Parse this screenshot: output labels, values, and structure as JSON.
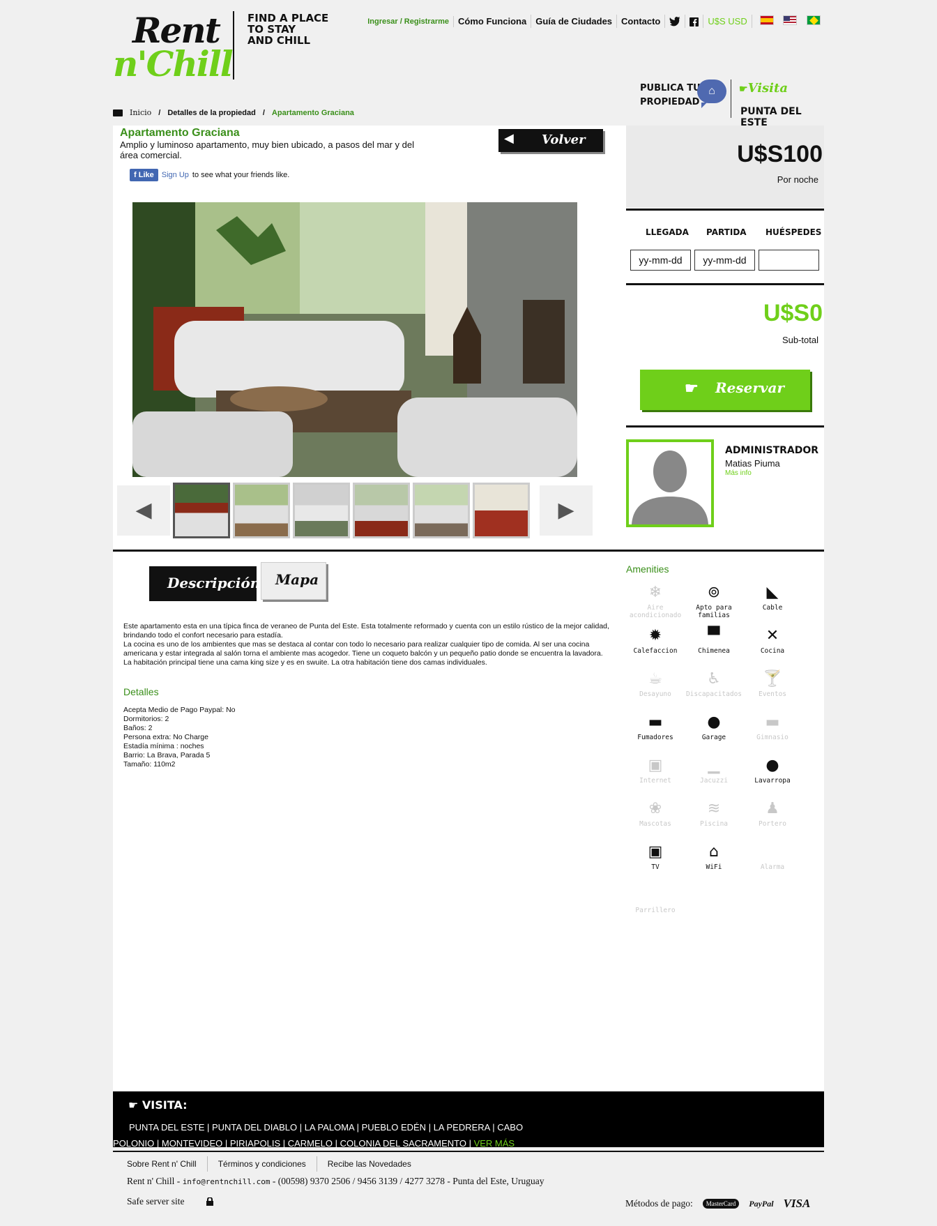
{
  "header": {
    "logo_line1": "Rent",
    "logo_line2": "n'Chill",
    "tagline_l1": "FIND A PLACE",
    "tagline_l2": "TO STAY",
    "tagline_l3": "AND CHILL",
    "nav": {
      "login": "Ingresar / Registrarme",
      "como": "Cómo Funciona",
      "guia": "Guía de Ciudades",
      "contacto": "Contacto",
      "currency": "U$S USD"
    },
    "publica_l1": "PUBLICA TU",
    "publica_l2": "PROPIEDAD",
    "visita": "Visita",
    "visita_city": "PUNTA DEL ESTE",
    "accent": "#6fcf1a"
  },
  "breadcrumb": {
    "home": "Inicio",
    "details": "Detalles de la propiedad",
    "current": "Apartamento Graciana"
  },
  "property": {
    "title": "Apartamento Graciana",
    "subtitle": "Amplio y luminoso apartamento, muy bien ubicado, a pasos del mar y del área comercial.",
    "volver": "Volver",
    "fb_like": "Like",
    "fb_signup": "Sign Up",
    "fb_text": "to see what your friends like."
  },
  "booking": {
    "price": "U$S100",
    "per_night": "Por noche",
    "llegada": "LLEGADA",
    "partida": "PARTIDA",
    "huespedes": "HUÉSPEDES",
    "llegada_placeholder": "yy-mm-dd",
    "partida_placeholder": "yy-mm-dd",
    "subtotal": "U$S0",
    "subtotal_label": "Sub-total",
    "reservar": "Reservar"
  },
  "admin": {
    "heading": "ADMINISTRADOR",
    "name": "Matias Piuma",
    "more": "Más info"
  },
  "tabs": {
    "descripcion": "Descripción",
    "mapa": "Mapa"
  },
  "description": {
    "p1": "Este apartamento esta en una típica finca de veraneo de Punta del Este. Esta totalmente reformado y cuenta con un estilo rústico de la mejor calidad, brindando todo el confort necesario para estadía.",
    "p2": "La cocina es uno de los ambientes que mas se destaca al contar con todo lo necesario para realizar cualquier tipo de comida. Al ser una cocina americana y estar integrada al salón torna el ambiente mas acogedor. Tiene un coqueto balcón y un pequeño patio donde se encuentra la lavadora.",
    "p3": "La habitación principal tiene una cama king size y es en swuite. La otra habitación tiene dos camas individuales."
  },
  "details": {
    "heading": "Detalles",
    "lines": [
      "Acepta Medio de Pago Paypal: No",
      "Dormitorios: 2",
      "Baños: 2",
      "Persona extra: No Charge",
      "Estadía mínima : noches",
      "Barrio: La Brava, Parada 5",
      "Tamaño: 110m2"
    ]
  },
  "amenities": {
    "heading": "Amenities",
    "items": [
      {
        "label": "Aire acondicionado",
        "on": false,
        "icon": "snowflake-icon",
        "glyph": "❄"
      },
      {
        "label": "Apto para familias",
        "on": true,
        "icon": "lollipop-icon",
        "glyph": "⊚"
      },
      {
        "label": "Cable",
        "on": true,
        "icon": "satellite-icon",
        "glyph": "◣"
      },
      {
        "label": "Calefaccion",
        "on": true,
        "icon": "heater-icon",
        "glyph": "✹"
      },
      {
        "label": "Chimenea",
        "on": true,
        "icon": "chimney-icon",
        "glyph": "▀"
      },
      {
        "label": "Cocina",
        "on": true,
        "icon": "utensils-icon",
        "glyph": "✕"
      },
      {
        "label": "Desayuno",
        "on": false,
        "icon": "cup-icon",
        "glyph": "☕"
      },
      {
        "label": "Discapacitados",
        "on": false,
        "icon": "wheelchair-icon",
        "glyph": "♿"
      },
      {
        "label": "Eventos",
        "on": false,
        "icon": "cocktail-icon",
        "glyph": "🍸"
      },
      {
        "label": "Fumadores",
        "on": true,
        "icon": "cigarette-icon",
        "glyph": "▬"
      },
      {
        "label": "Garage",
        "on": true,
        "icon": "car-icon",
        "glyph": "●"
      },
      {
        "label": "Gimnasio",
        "on": false,
        "icon": "dumbbell-icon",
        "glyph": "▬"
      },
      {
        "label": "Internet",
        "on": false,
        "icon": "internet-icon",
        "glyph": "▣"
      },
      {
        "label": "Jacuzzi",
        "on": false,
        "icon": "bathtub-icon",
        "glyph": "▁"
      },
      {
        "label": "Lavarropa",
        "on": true,
        "icon": "drop-icon",
        "glyph": "●"
      },
      {
        "label": "Mascotas",
        "on": false,
        "icon": "paw-icon",
        "glyph": "❀"
      },
      {
        "label": "Piscina",
        "on": false,
        "icon": "waves-icon",
        "glyph": "≋"
      },
      {
        "label": "Portero",
        "on": false,
        "icon": "doorman-icon",
        "glyph": "♟"
      },
      {
        "label": "TV",
        "on": true,
        "icon": "tv-icon",
        "glyph": "▣"
      },
      {
        "label": "WiFi",
        "on": true,
        "icon": "wifi-router-icon",
        "glyph": "⌂"
      },
      {
        "label": "Alarma",
        "on": false,
        "icon": "alarm-icon",
        "glyph": ""
      },
      {
        "label": "Parrillero",
        "on": false,
        "icon": "grill-icon",
        "glyph": ""
      }
    ]
  },
  "footer": {
    "visita": "VISITA:",
    "cities": [
      "PUNTA DEL ESTE",
      "PUNTA DEL DIABLO",
      "LA PALOMA",
      "PUEBLO EDÉN",
      "LA PEDRERA",
      "CABO POLONIO",
      "MONTEVIDEO",
      "PIRIAPOLIS",
      "CARMELO",
      "COLONIA DEL SACRAMENTO"
    ],
    "ver_mas": "VER MÁS",
    "links": [
      "Sobre Rent n' Chill",
      "Términos y condiciones",
      "Recibe las Novedades"
    ],
    "contact_prefix": "Rent n' Chill - ",
    "email": "info@rentnchill.com",
    "contact_suffix": " - (00598) 9370 2506 / 9456 3139 / 4277 3278 - Punta del Este, Uruguay",
    "safe": "Safe server site",
    "pago": "Métodos de pago:",
    "mastercard": "MasterCard",
    "paypal": "PayPal",
    "visa": "VISA"
  }
}
